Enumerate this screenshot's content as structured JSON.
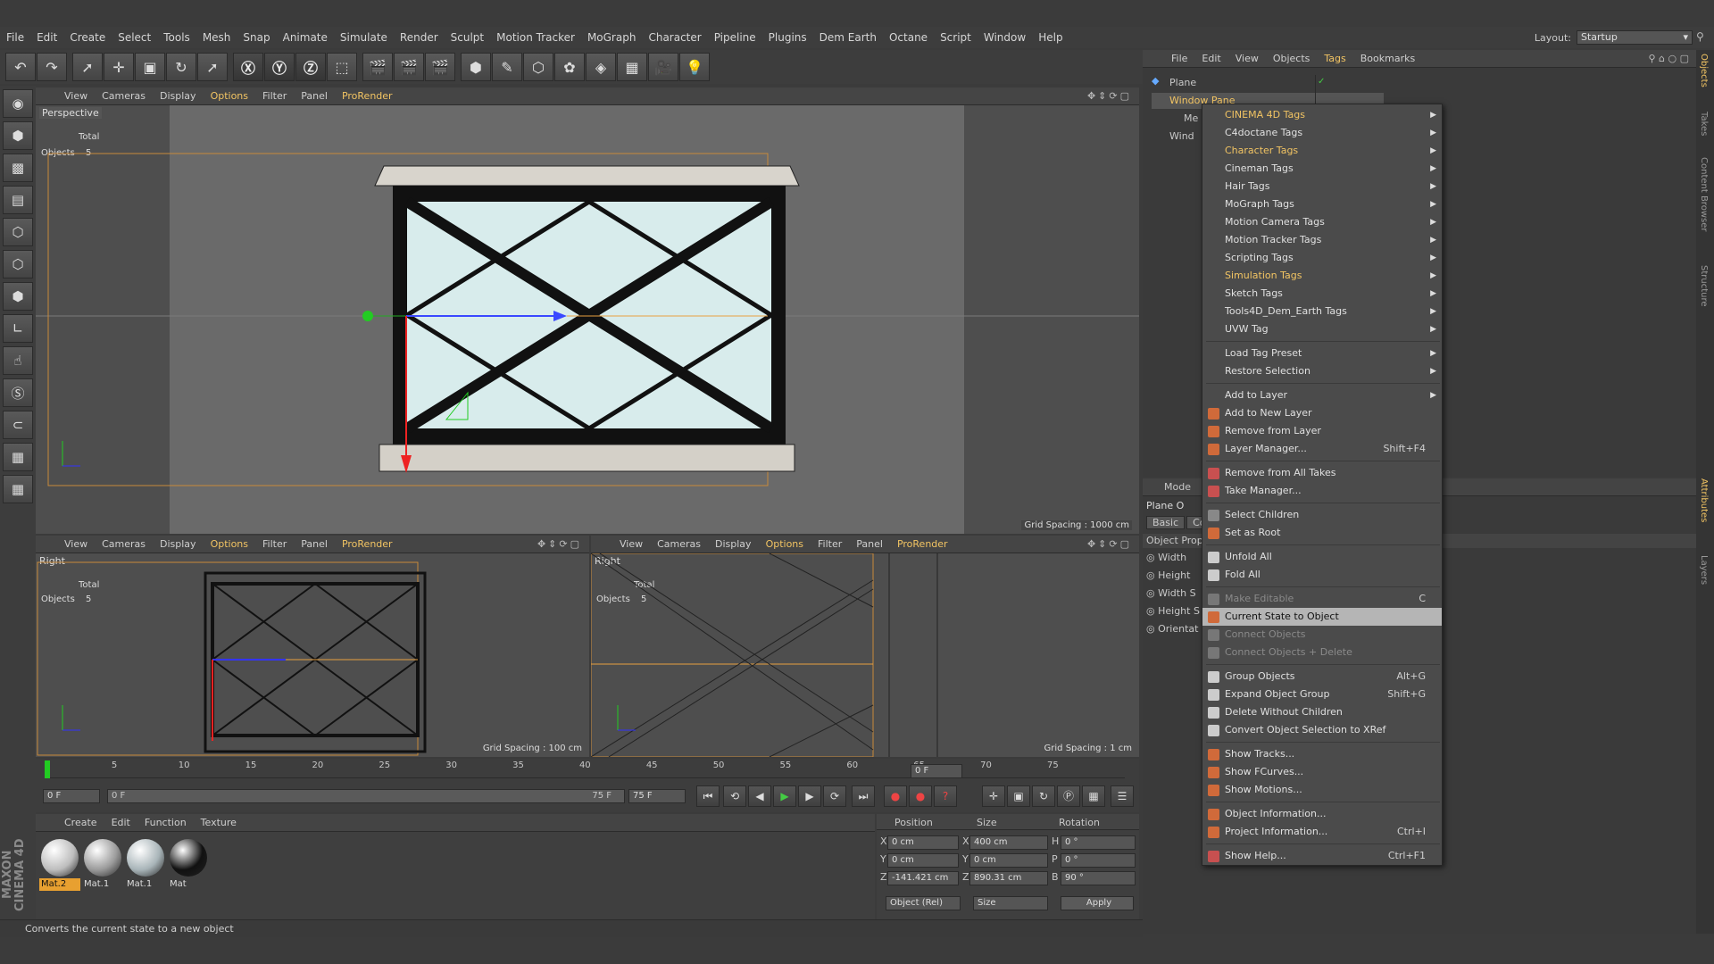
{
  "menubar": {
    "items": [
      "File",
      "Edit",
      "Create",
      "Select",
      "Tools",
      "Mesh",
      "Snap",
      "Animate",
      "Simulate",
      "Render",
      "Sculpt",
      "Motion Tracker",
      "MoGraph",
      "Character",
      "Pipeline",
      "Plugins",
      "Dem Earth",
      "Octane",
      "Script",
      "Window",
      "Help"
    ],
    "layout_label": "Layout:",
    "layout_value": "Startup"
  },
  "viewport_menu": {
    "items": [
      "View",
      "Cameras",
      "Display",
      "Options",
      "Filter",
      "Panel",
      "ProRender"
    ]
  },
  "viewports": {
    "persp": {
      "label": "Perspective",
      "total": "Total",
      "objects_label": "Objects",
      "objects_value": "5",
      "grid": "Grid Spacing : 1000 cm"
    },
    "right1": {
      "label": "Right",
      "total": "Total",
      "objects_label": "Objects",
      "objects_value": "5",
      "grid": "Grid Spacing : 100 cm"
    },
    "right2": {
      "label": "Right",
      "total": "Total",
      "objects_label": "Objects",
      "objects_value": "5",
      "grid": "Grid Spacing : 1 cm"
    }
  },
  "timeline": {
    "ticks": [
      "0",
      "5",
      "10",
      "15",
      "20",
      "25",
      "30",
      "35",
      "40",
      "45",
      "50",
      "55",
      "60",
      "65",
      "70",
      "75"
    ],
    "frame_right": "0 F",
    "start": "0 F",
    "range_start": "0 F",
    "range_end": "75 F",
    "end": "75 F",
    "progress": 0
  },
  "material_panel": {
    "menu": [
      "Create",
      "Edit",
      "Function",
      "Texture"
    ],
    "materials": [
      {
        "name": "Mat.2",
        "color": "#bdbdbd",
        "selected": true
      },
      {
        "name": "Mat.1",
        "color": "#9a9a9a",
        "selected": false
      },
      {
        "name": "Mat.1",
        "color": "#a8b4b8",
        "selected": false
      },
      {
        "name": "Mat",
        "color": "#111111",
        "selected": false
      }
    ]
  },
  "coords": {
    "headers": [
      "Position",
      "Size",
      "Rotation"
    ],
    "rows": [
      {
        "axis": "X",
        "pos": "0 cm",
        "saxis": "X",
        "size": "400 cm",
        "raxis": "H",
        "rot": "0 °"
      },
      {
        "axis": "Y",
        "pos": "0 cm",
        "saxis": "Y",
        "size": "0 cm",
        "raxis": "P",
        "rot": "0 °"
      },
      {
        "axis": "Z",
        "pos": "-141.421 cm",
        "saxis": "Z",
        "size": "890.31 cm",
        "raxis": "B",
        "rot": "90 °"
      }
    ],
    "mode1": "Object (Rel)",
    "mode2": "Size",
    "apply": "Apply"
  },
  "status": "Converts the current state to a new object",
  "maxon": "MAXON CINEMA 4D",
  "object_manager": {
    "menu": [
      "File",
      "Edit",
      "View",
      "Objects",
      "Tags",
      "Bookmarks"
    ],
    "objects": [
      {
        "name": "Plane"
      },
      {
        "name": "Window Pane"
      },
      {
        "name": "Me"
      },
      {
        "name": "Wind"
      }
    ]
  },
  "attr_manager": {
    "mode": "Mode",
    "obj": "Plane O",
    "tabs": [
      "Basic",
      "Co"
    ],
    "section": "Object Prop",
    "props": [
      "Width",
      "Height",
      "Width S",
      "Height S",
      "Orientat"
    ]
  },
  "right_tabs": [
    "Objects",
    "Takes",
    "Content Browser",
    "Structure",
    "Attributes",
    "Layers"
  ],
  "context_menu": {
    "items": [
      {
        "label": "CINEMA 4D Tags",
        "sub": true,
        "hl": true
      },
      {
        "label": "C4doctane Tags",
        "sub": true
      },
      {
        "label": "Character Tags",
        "sub": true,
        "hl": true
      },
      {
        "label": "Cineman Tags",
        "sub": true
      },
      {
        "label": "Hair Tags",
        "sub": true
      },
      {
        "label": "MoGraph Tags",
        "sub": true
      },
      {
        "label": "Motion Camera Tags",
        "sub": true
      },
      {
        "label": "Motion Tracker Tags",
        "sub": true
      },
      {
        "label": "Scripting Tags",
        "sub": true
      },
      {
        "label": "Simulation Tags",
        "sub": true,
        "hl": true
      },
      {
        "label": "Sketch Tags",
        "sub": true
      },
      {
        "label": "Tools4D_Dem_Earth Tags",
        "sub": true
      },
      {
        "label": "UVW Tag",
        "sub": true
      },
      {
        "sep": true
      },
      {
        "label": "Load Tag Preset",
        "sub": true
      },
      {
        "label": "Restore Selection",
        "sub": true
      },
      {
        "sep": true
      },
      {
        "label": "Add to Layer",
        "sub": true
      },
      {
        "label": "Add to New Layer",
        "icon": "#d06a3a"
      },
      {
        "label": "Remove from Layer",
        "icon": "#d06a3a"
      },
      {
        "label": "Layer Manager...",
        "icon": "#d06a3a",
        "shortcut": "Shift+F4"
      },
      {
        "sep": true
      },
      {
        "label": "Remove from All Takes",
        "icon": "#c85050"
      },
      {
        "label": "Take Manager...",
        "icon": "#c85050"
      },
      {
        "sep": true
      },
      {
        "label": "Select Children",
        "icon": "#888"
      },
      {
        "label": "Set as Root",
        "icon": "#d06a3a"
      },
      {
        "sep": true
      },
      {
        "label": "Unfold All",
        "icon": "#ccc"
      },
      {
        "label": "Fold All",
        "icon": "#ccc"
      },
      {
        "sep": true
      },
      {
        "label": "Make Editable",
        "icon": "#777",
        "dis": true,
        "shortcut": "C"
      },
      {
        "label": "Current State to Object",
        "icon": "#d06a3a",
        "sel": true
      },
      {
        "label": "Connect Objects",
        "icon": "#777",
        "dis": true
      },
      {
        "label": "Connect Objects + Delete",
        "icon": "#777",
        "dis": true
      },
      {
        "sep": true
      },
      {
        "label": "Group Objects",
        "icon": "#ccc",
        "shortcut": "Alt+G"
      },
      {
        "label": "Expand Object Group",
        "icon": "#ccc",
        "shortcut": "Shift+G"
      },
      {
        "label": "Delete Without Children",
        "icon": "#ccc"
      },
      {
        "label": "Convert Object Selection to XRef",
        "icon": "#ccc"
      },
      {
        "sep": true
      },
      {
        "label": "Show Tracks...",
        "icon": "#d06a3a"
      },
      {
        "label": "Show FCurves...",
        "icon": "#d06a3a"
      },
      {
        "label": "Show Motions...",
        "icon": "#d06a3a"
      },
      {
        "sep": true
      },
      {
        "label": "Object Information...",
        "icon": "#d06a3a"
      },
      {
        "label": "Project Information...",
        "icon": "#d06a3a",
        "shortcut": "Ctrl+I"
      },
      {
        "sep": true
      },
      {
        "label": "Show Help...",
        "icon": "#c85050",
        "shortcut": "Ctrl+F1"
      }
    ]
  }
}
